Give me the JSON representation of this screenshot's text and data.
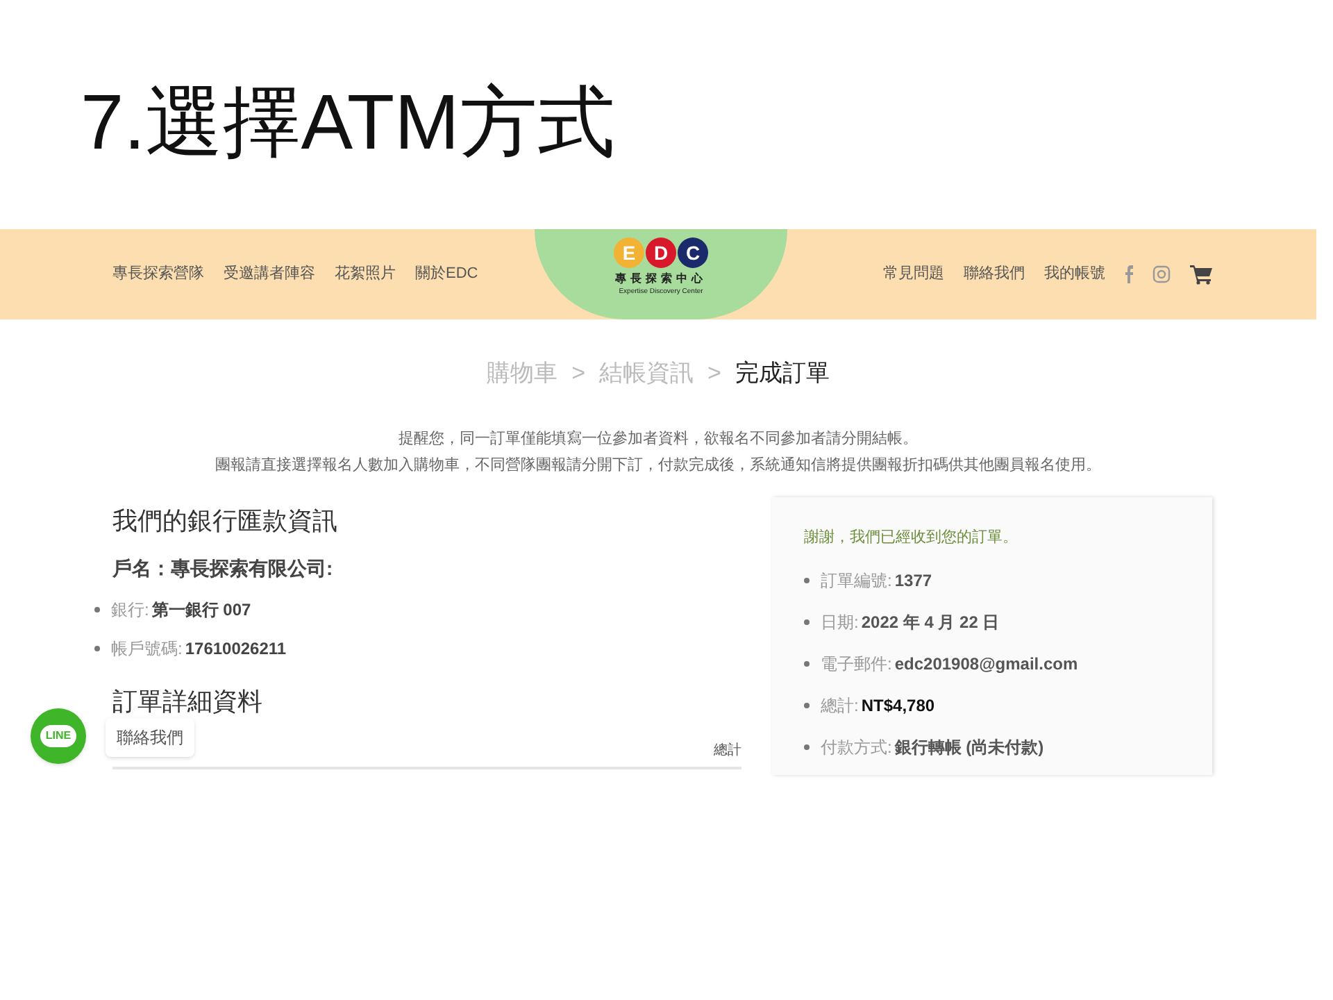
{
  "slide_title": "7.選擇ATM方式",
  "header": {
    "nav_left": [
      "專長探索營隊",
      "受邀講者陣容",
      "花絮照片",
      "關於EDC"
    ],
    "logo": {
      "letters": [
        "E",
        "D",
        "C"
      ],
      "name": "專長探索中心",
      "subtitle": "Expertise Discovery Center"
    },
    "nav_right": [
      "常見問題",
      "聯絡我們",
      "我的帳號"
    ]
  },
  "breadcrumb": [
    {
      "label": "購物車",
      "selected": false
    },
    {
      "label": "結帳資訊",
      "selected": false
    },
    {
      "label": "完成訂單",
      "selected": true
    }
  ],
  "breadcrumb_separator": ">",
  "notices": [
    "提醒您，同一訂單僅能填寫一位參加者資料，欲報名不同參加者請分開結帳。",
    "團報請直接選擇報名人數加入購物車，不同營隊團報請分開下訂，付款完成後，系統通知信將提供團報折扣碼供其他團員報名使用。"
  ],
  "bank": {
    "title": "我們的銀行匯款資訊",
    "account_name": "戶名：專長探索有限公司:",
    "items": [
      {
        "label": "銀行:",
        "value": "第一銀行 007"
      },
      {
        "label": "帳戶號碼:",
        "value": "17610026211"
      }
    ]
  },
  "order_details": {
    "title": "訂單詳細資料",
    "column_total": "總計"
  },
  "summary": {
    "thanks": "謝謝，我們已經收到您的訂單。",
    "items": [
      {
        "label": "訂單編號:",
        "value": "1377",
        "emphasis": false
      },
      {
        "label": "日期:",
        "value": "2022 年 4 月 22 日",
        "emphasis": false
      },
      {
        "label": "電子郵件:",
        "value": "edc201908@gmail.com",
        "emphasis": false
      },
      {
        "label": "總計:",
        "value": "NT$4,780",
        "emphasis": true
      },
      {
        "label": "付款方式:",
        "value": "銀行轉帳 (尚未付款)",
        "emphasis": false
      }
    ]
  },
  "chat": {
    "badge": "LINE",
    "tooltip": "聯絡我們"
  }
}
